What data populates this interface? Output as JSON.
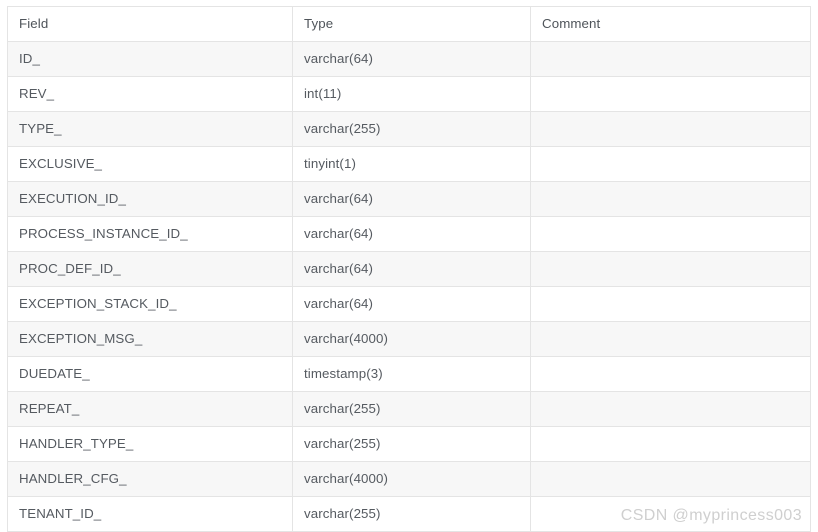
{
  "table": {
    "columns": [
      {
        "key": "field",
        "label": "Field"
      },
      {
        "key": "type",
        "label": "Type"
      },
      {
        "key": "comment",
        "label": "Comment"
      }
    ],
    "rows": [
      {
        "field": "ID_",
        "type": "varchar(64)",
        "comment": ""
      },
      {
        "field": "REV_",
        "type": "int(11)",
        "comment": ""
      },
      {
        "field": "TYPE_",
        "type": "varchar(255)",
        "comment": ""
      },
      {
        "field": "EXCLUSIVE_",
        "type": "tinyint(1)",
        "comment": ""
      },
      {
        "field": "EXECUTION_ID_",
        "type": "varchar(64)",
        "comment": ""
      },
      {
        "field": "PROCESS_INSTANCE_ID_",
        "type": "varchar(64)",
        "comment": ""
      },
      {
        "field": "PROC_DEF_ID_",
        "type": "varchar(64)",
        "comment": ""
      },
      {
        "field": "EXCEPTION_STACK_ID_",
        "type": "varchar(64)",
        "comment": ""
      },
      {
        "field": "EXCEPTION_MSG_",
        "type": "varchar(4000)",
        "comment": ""
      },
      {
        "field": "DUEDATE_",
        "type": "timestamp(3)",
        "comment": ""
      },
      {
        "field": "REPEAT_",
        "type": "varchar(255)",
        "comment": ""
      },
      {
        "field": "HANDLER_TYPE_",
        "type": "varchar(255)",
        "comment": ""
      },
      {
        "field": "HANDLER_CFG_",
        "type": "varchar(4000)",
        "comment": ""
      },
      {
        "field": "TENANT_ID_",
        "type": "varchar(255)",
        "comment": ""
      }
    ]
  },
  "watermark": {
    "text": "CSDN @myprincess003"
  },
  "colors": {
    "border": "#e4e4e4",
    "row_alt_bg": "#f7f7f7",
    "row_bg": "#ffffff",
    "text": "#555a60",
    "watermark": "#cfcfcf"
  }
}
